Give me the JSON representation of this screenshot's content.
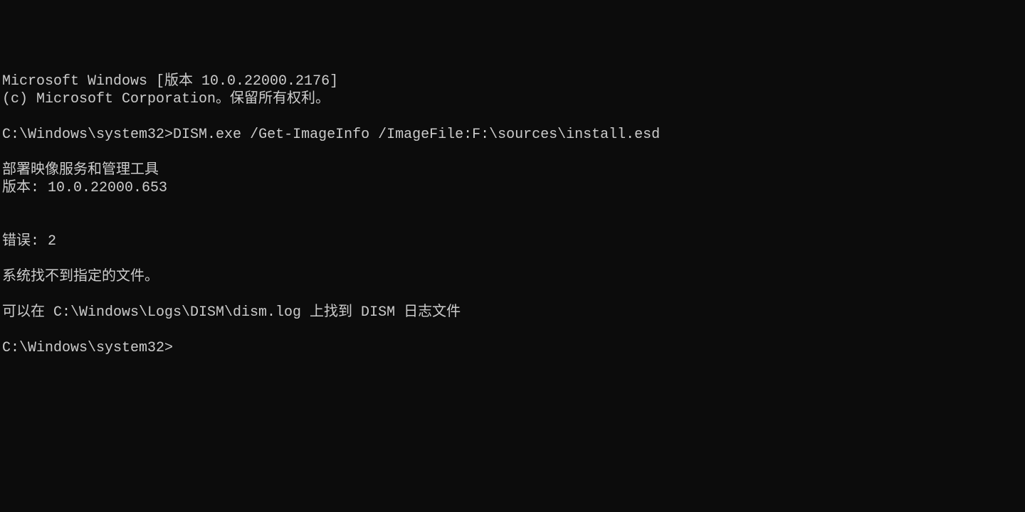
{
  "terminal": {
    "header_line1": "Microsoft Windows [版本 10.0.22000.2176]",
    "header_line2": "(c) Microsoft Corporation。保留所有权利。",
    "prompt1": "C:\\Windows\\system32>",
    "command1": "DISM.exe /Get-ImageInfo /ImageFile:F:\\sources\\install.esd",
    "tool_name": "部署映像服务和管理工具",
    "tool_version": "版本: 10.0.22000.653",
    "error_label": "错误: 2",
    "error_message": "系统找不到指定的文件。",
    "log_message": "可以在 C:\\Windows\\Logs\\DISM\\dism.log 上找到 DISM 日志文件",
    "prompt2": "C:\\Windows\\system32>"
  }
}
